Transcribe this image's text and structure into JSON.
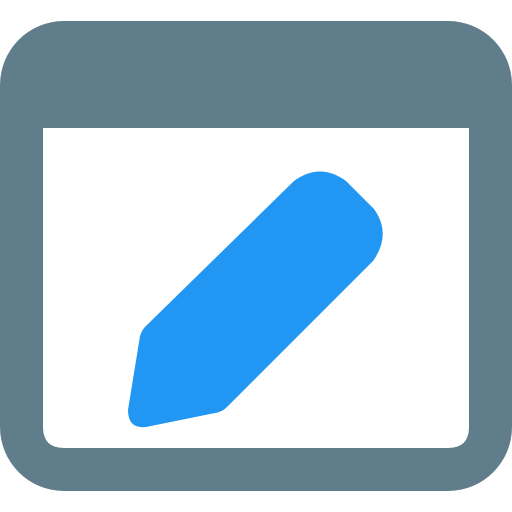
{
  "icon": {
    "name": "edit-window-icon",
    "frame_color": "#607D8B",
    "content_color": "#FFFFFF",
    "pencil_color": "#2196F3"
  }
}
